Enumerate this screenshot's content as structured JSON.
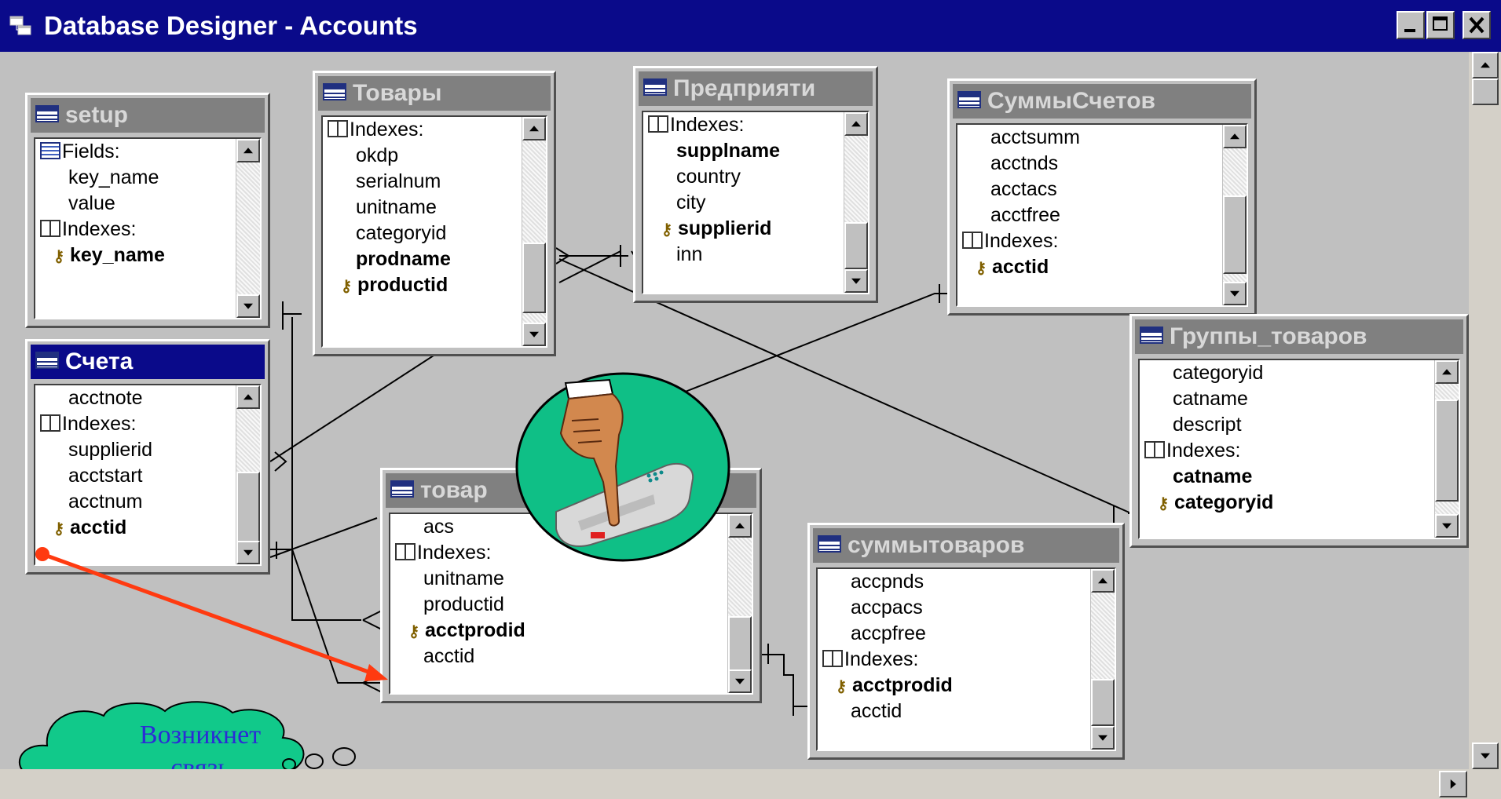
{
  "window": {
    "title": "Database Designer - Accounts",
    "buttons": [
      "minimize",
      "maximize",
      "close"
    ]
  },
  "tables": {
    "setup": {
      "title": "setup",
      "rows": [
        {
          "text": "Fields:",
          "kind": "section-fields"
        },
        {
          "text": "key_name",
          "kind": "field"
        },
        {
          "text": "value",
          "kind": "field"
        },
        {
          "text": "Indexes:",
          "kind": "section-indexes"
        },
        {
          "text": "key_name",
          "kind": "key"
        }
      ]
    },
    "tovary": {
      "title": "Товары",
      "rows": [
        {
          "text": "Indexes:",
          "kind": "section-indexes"
        },
        {
          "text": "okdp",
          "kind": "field"
        },
        {
          "text": "serialnum",
          "kind": "field"
        },
        {
          "text": "unitname",
          "kind": "field"
        },
        {
          "text": "categoryid",
          "kind": "field"
        },
        {
          "text": "prodname",
          "kind": "bold"
        },
        {
          "text": "productid",
          "kind": "key"
        }
      ]
    },
    "predpriyatiya": {
      "title": "Предприяти",
      "rows": [
        {
          "text": "Indexes:",
          "kind": "section-indexes"
        },
        {
          "text": "supplname",
          "kind": "bold"
        },
        {
          "text": "country",
          "kind": "field"
        },
        {
          "text": "city",
          "kind": "field"
        },
        {
          "text": "supplierid",
          "kind": "key"
        },
        {
          "text": "inn",
          "kind": "field"
        }
      ]
    },
    "summy_schetov": {
      "title": "СуммыСчетов",
      "rows": [
        {
          "text": "acctsumm",
          "kind": "field"
        },
        {
          "text": "acctnds",
          "kind": "field"
        },
        {
          "text": "acctacs",
          "kind": "field"
        },
        {
          "text": "acctfree",
          "kind": "field"
        },
        {
          "text": "Indexes:",
          "kind": "section-indexes"
        },
        {
          "text": "acctid",
          "kind": "key"
        }
      ]
    },
    "gruppy_tovarov": {
      "title": "Группы_товаров",
      "rows": [
        {
          "text": "categoryid",
          "kind": "field"
        },
        {
          "text": "catname",
          "kind": "field"
        },
        {
          "text": "descript",
          "kind": "field"
        },
        {
          "text": "Indexes:",
          "kind": "section-indexes"
        },
        {
          "text": "catname",
          "kind": "bold"
        },
        {
          "text": "categoryid",
          "kind": "key"
        }
      ]
    },
    "scheta": {
      "title": "Счета",
      "active": true,
      "rows": [
        {
          "text": "acctnote",
          "kind": "field"
        },
        {
          "text": "Indexes:",
          "kind": "section-indexes"
        },
        {
          "text": "supplierid",
          "kind": "field"
        },
        {
          "text": "acctstart",
          "kind": "field"
        },
        {
          "text": "acctnum",
          "kind": "field"
        },
        {
          "text": "acctid",
          "kind": "key"
        }
      ]
    },
    "tovary_scheta": {
      "title": "товар",
      "rows": [
        {
          "text": "acs",
          "kind": "field"
        },
        {
          "text": "Indexes:",
          "kind": "section-indexes"
        },
        {
          "text": "unitname",
          "kind": "field"
        },
        {
          "text": "productid",
          "kind": "field"
        },
        {
          "text": "acctprodid",
          "kind": "key"
        },
        {
          "text": "acctid",
          "kind": "field"
        }
      ]
    },
    "summy_tovarov": {
      "title": "суммытоваров",
      "rows": [
        {
          "text": "accpnds",
          "kind": "field"
        },
        {
          "text": "accpacs",
          "kind": "field"
        },
        {
          "text": "accpfree",
          "kind": "field"
        },
        {
          "text": "Indexes:",
          "kind": "section-indexes"
        },
        {
          "text": "acctprodid",
          "kind": "key"
        },
        {
          "text": "acctid",
          "kind": "field"
        }
      ]
    }
  },
  "callout": {
    "line1": "Возникнет",
    "line2": "связь"
  },
  "colors": {
    "titlebar": "#0a0a8a",
    "annotation_arrow": "#ff3a10",
    "cloud_fill": "#11c98a",
    "hand_circle": "#0fbf86"
  }
}
